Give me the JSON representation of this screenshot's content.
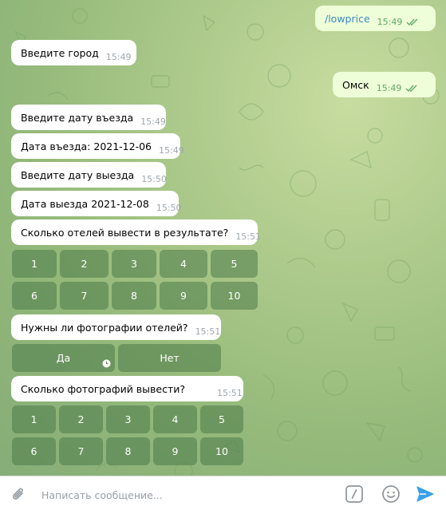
{
  "messages": {
    "m1": {
      "text": "/lowprice",
      "time": "15:49"
    },
    "m2": {
      "text": "Введите город",
      "time": "15:49"
    },
    "m3": {
      "text": "Омск",
      "time": "15:49"
    },
    "m4": {
      "text": "Введите дату въезда",
      "time": "15:49"
    },
    "m5": {
      "text": "Дата въезда: 2021-12-06",
      "time": "15:49"
    },
    "m6": {
      "text": "Введите дату выезда",
      "time": "15:50"
    },
    "m7": {
      "text": "Дата выезда 2021-12-08",
      "time": "15:50"
    },
    "m8": {
      "text": "Сколько отелей вывести в результате?",
      "time": "15:51"
    },
    "m9": {
      "text": "Нужны ли фотографии отелей?",
      "time": "15:51"
    },
    "m10": {
      "text": "Сколько фотографий вывести?",
      "time": "15:51"
    }
  },
  "keyboards": {
    "hotels": [
      "1",
      "2",
      "3",
      "4",
      "5",
      "6",
      "7",
      "8",
      "9",
      "10"
    ],
    "photos_yesno": [
      "Да",
      "Нет"
    ],
    "photos_count": [
      "1",
      "2",
      "3",
      "4",
      "5",
      "6",
      "7",
      "8",
      "9",
      "10"
    ]
  },
  "input": {
    "placeholder": "Написать сообщение..."
  },
  "colors": {
    "incoming_bubble": "#ffffff",
    "outgoing_bubble": "#eefed8",
    "time_text": "#a0a7ad",
    "read_check": "#62a86a",
    "command_link": "#3b87c5",
    "send_icon": "#3aa1e6"
  },
  "icons": {
    "attach": "paperclip-icon",
    "bot_command": "slash-command-icon",
    "emoji": "smile-icon",
    "send": "send-icon",
    "read": "double-check-icon",
    "pending": "clock-icon"
  }
}
